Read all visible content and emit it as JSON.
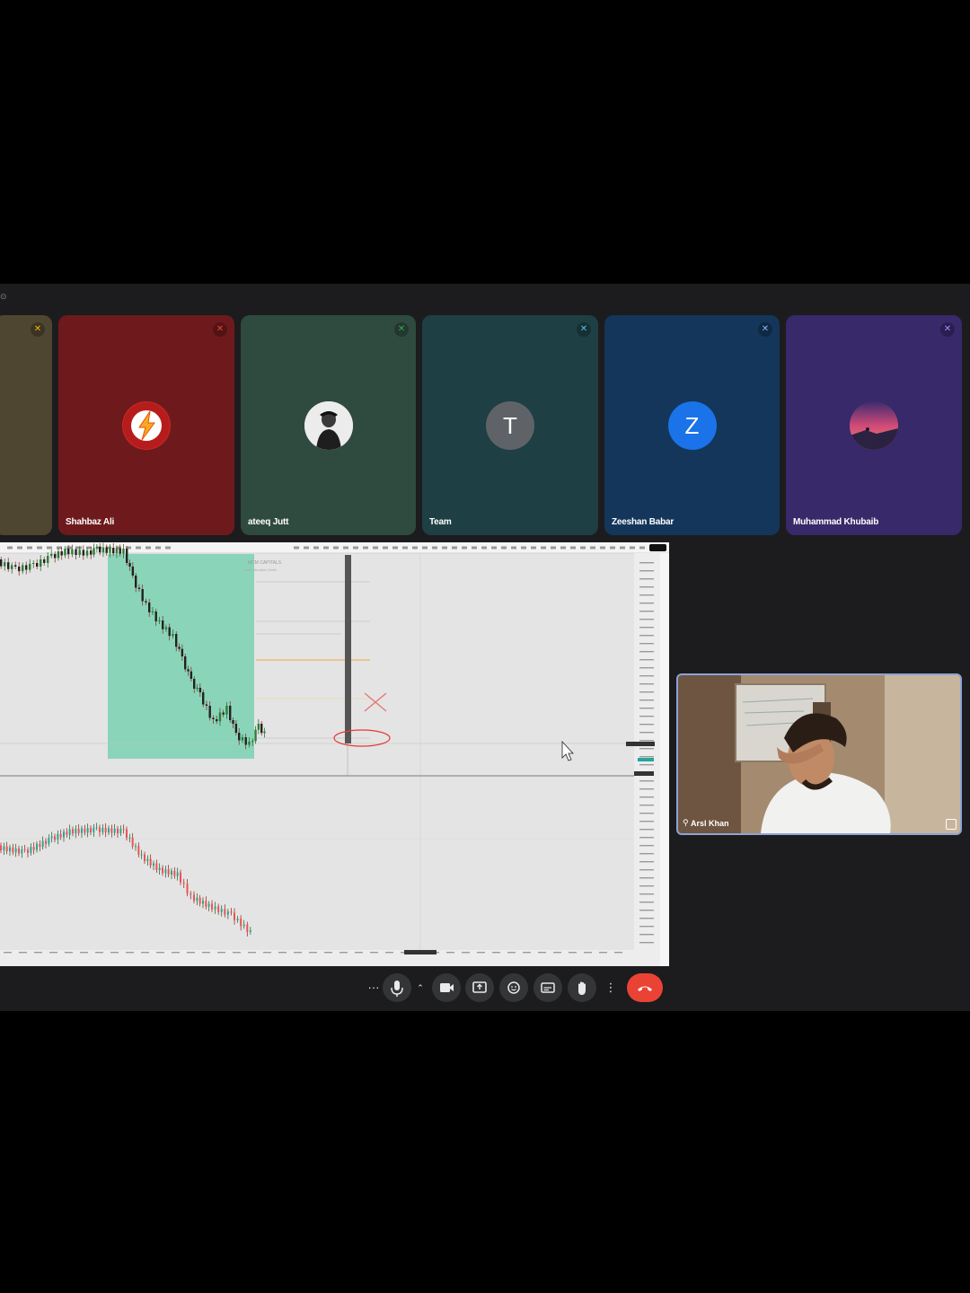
{
  "participants": [
    {
      "name": "",
      "color": "#4e4630",
      "mic_color": "#f4b400"
    },
    {
      "name": "Shahbaz Ali",
      "color": "#6e1a1d",
      "mic_color": "#ea4335",
      "avatar_type": "flash-logo"
    },
    {
      "name": "ateeq Jutt",
      "color": "#2f4a3f",
      "mic_color": "#34a853",
      "avatar_type": "photo"
    },
    {
      "name": "Team",
      "color": "#1e3f43",
      "mic_color": "#4fc3f7",
      "avatar_letter": "T",
      "avatar_color": "#5f6368"
    },
    {
      "name": "Zeeshan Babar",
      "color": "#14365a",
      "mic_color": "#8ab4f8",
      "avatar_letter": "Z",
      "avatar_color": "#1a73e8"
    },
    {
      "name": "Muhammad Khubaib",
      "color": "#37296a",
      "mic_color": "#a78bfa",
      "avatar_type": "sunset-photo"
    }
  ],
  "screen_share": {
    "watermark_title": "MCM CAPITALS",
    "watermark_sub": "Forex Education Center"
  },
  "self_view": {
    "name": "Arsl Khan"
  },
  "controls": {
    "items": [
      "more-options",
      "microphone",
      "chevron-up",
      "camera",
      "present",
      "emoji",
      "captions",
      "raise-hand",
      "kebab-menu",
      "end-call"
    ]
  },
  "colors": {
    "bg": "#1c1c1e",
    "bull": "#26a69a",
    "bear": "#ef5350",
    "zone": "#7fd3b5",
    "end_call": "#ea4335"
  }
}
